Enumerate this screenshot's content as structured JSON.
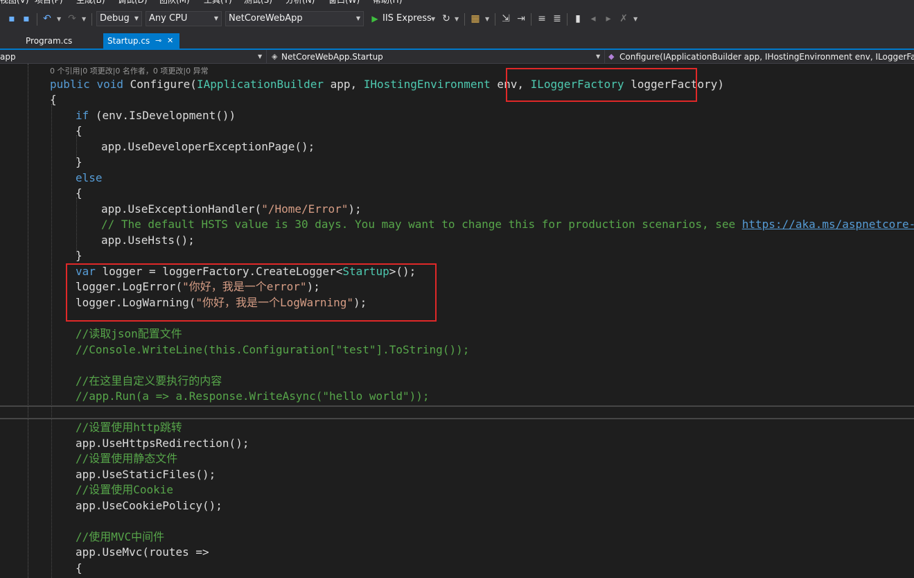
{
  "menu": [
    "视图(V)",
    "项目(P)",
    "生成(B)",
    "调试(D)",
    "团队(M)",
    "工具(T)",
    "测试(S)",
    "分析(N)",
    "窗口(W)",
    "帮助(H)"
  ],
  "toolbar": {
    "config": "Debug",
    "platform": "Any CPU",
    "project": "NetCoreWebApp",
    "run_label": "IIS Express"
  },
  "tabs": [
    {
      "label": "Program.cs",
      "active": false
    },
    {
      "label": "Startup.cs",
      "active": true,
      "pin": "⊸",
      "close": "✕"
    }
  ],
  "nav": {
    "project": "app",
    "class": "NetCoreWebApp.Startup",
    "member": "Configure(IApplicationBuilder app, IHostingEnvironment env, ILoggerFactory loggerFactory)"
  },
  "code": {
    "codelens": "0 个引用|0 项更改|0 名作者，0 项更改|0 异常",
    "sig_public": "public",
    "sig_void": "void",
    "sig_name": " Configure(",
    "sig_t1": "IApplicationBuilder",
    "sig_p1": " app, ",
    "sig_t2": "IHostingEnvironment",
    "sig_p2": " env, ",
    "sig_t3": "ILoggerFactory",
    "sig_p3": " loggerFactory)",
    "brace_open": "{",
    "brace_close": "}",
    "if_kw": "if",
    "if_rest": " (env.IsDevelopment())",
    "dev_page": "app.UseDeveloperExceptionPage();",
    "else_kw": "else",
    "exh_a": "app.UseExceptionHandler(",
    "exh_s": "\"/Home/Error\"",
    "exh_b": ");",
    "hsts_comment": "// The default HSTS value is 30 days. You may want to change this for production scenarios, see ",
    "hsts_link": "https://aka.ms/aspnetcore-hsts",
    "use_hsts": "app.UseHsts();",
    "var_kw": "var",
    "var_rest": " logger = loggerFactory.CreateLogger<",
    "var_type": "Startup",
    "var_end": ">();",
    "logerr_a": "logger.LogError(",
    "logerr_s": "\"你好，我是一个error\"",
    "logerr_b": ");",
    "logwarn_a": "logger.LogWarning(",
    "logwarn_s": "\"你好，我是一个LogWarning\"",
    "logwarn_b": ");",
    "cm_json": "//读取json配置文件",
    "cm_console": "//Console.WriteLine(this.Configuration[\"test\"].ToString());",
    "cm_custom": "//在这里自定义要执行的内容",
    "cm_run": "//app.Run(a => a.Response.WriteAsync(\"hello world\"));",
    "cm_http": "//设置使用http跳转",
    "https_redirect": "app.UseHttpsRedirection();",
    "cm_static": "//设置使用静态文件",
    "static_files": "app.UseStaticFiles();",
    "cm_cookie": "//设置使用Cookie",
    "cookie_policy": "app.UseCookiePolicy();",
    "cm_mvc": "//使用MVC中间件",
    "use_mvc": "app.UseMvc(routes =>"
  },
  "colors": {
    "keyword": "#569cd6",
    "type": "#4ec9b0",
    "string": "#d69d85",
    "comment": "#57a64a",
    "highlight_box": "#e02828",
    "tab_active": "#007acc"
  }
}
